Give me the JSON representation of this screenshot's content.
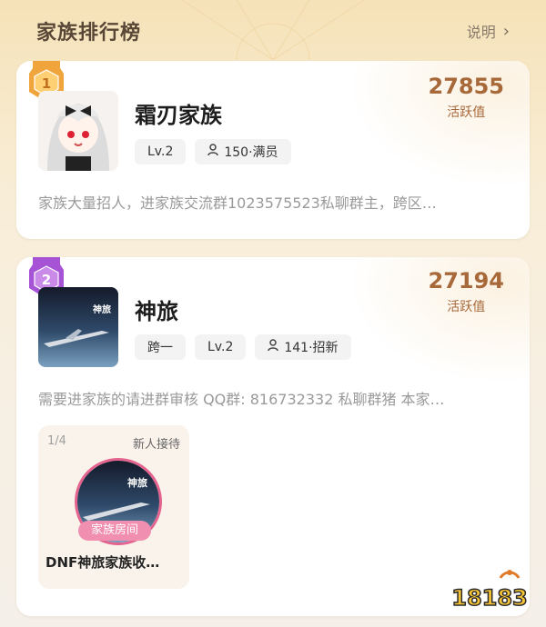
{
  "header": {
    "title": "家族排行榜",
    "link_label": "说明"
  },
  "families": [
    {
      "rank": "1",
      "name": "霜刃家族",
      "tags": [
        "Lv.2",
        "150·满员"
      ],
      "score": "27855",
      "score_label": "活跃值",
      "desc": "家族大量招人，进家族交流群1023575523私聊群主，跨区…",
      "rank_color": "#f0a43c"
    },
    {
      "rank": "2",
      "name": "神旅",
      "tags": [
        "跨一",
        "Lv.2",
        "141·招新"
      ],
      "score": "27194",
      "score_label": "活跃值",
      "desc": "需要进家族的请进群审核 QQ群: 816732332 私聊群猪 本家…",
      "rank_color": "#a653d6",
      "room": {
        "count": "1/4",
        "status": "新人接待",
        "pill": "家族房间",
        "name": "DNF神旅家族收…"
      }
    }
  ],
  "watermark": "18183",
  "colors": {
    "accent": "#a7683a",
    "pink": "#f08fb0"
  }
}
